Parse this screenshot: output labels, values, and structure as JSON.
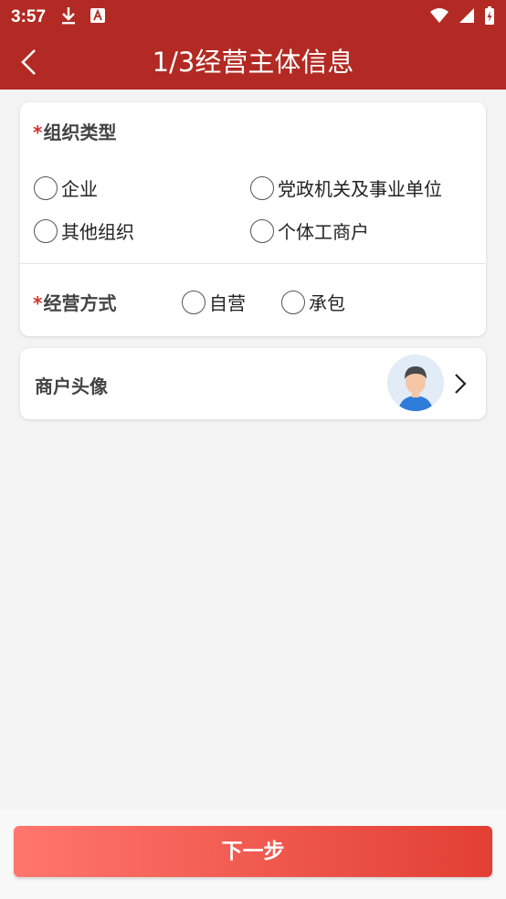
{
  "status_bar": {
    "time": "3:57",
    "icons": [
      "download-icon",
      "text-notification-icon",
      "wifi-icon",
      "signal-icon",
      "battery-charging-icon"
    ]
  },
  "nav": {
    "title": "1/3经营主体信息",
    "back_icon": "chevron-left-icon"
  },
  "org_type": {
    "required_mark": "*",
    "label": "组织类型",
    "options": [
      "企业",
      "党政机关及事业单位",
      "其他组织",
      "个体工商户"
    ]
  },
  "business_mode": {
    "required_mark": "*",
    "label": "经营方式",
    "options": [
      "自营",
      "承包"
    ]
  },
  "merchant_avatar": {
    "label": "商户头像",
    "avatar_icon": "user-avatar-icon",
    "chevron_icon": "chevron-right-icon"
  },
  "footer": {
    "next_label": "下一步"
  },
  "colors": {
    "header": "#b22a23",
    "required": "#d0342c",
    "button_start": "#ff766d",
    "button_end": "#e23f33"
  }
}
